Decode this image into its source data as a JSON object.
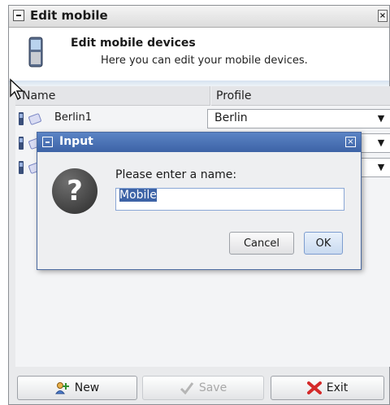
{
  "window": {
    "title": "Edit mobile",
    "header_title": "Edit mobile devices",
    "header_subtitle": "Here you can edit your mobile devices."
  },
  "table": {
    "columns": [
      "Name",
      "Profile"
    ],
    "rows": [
      {
        "name": "Berlin1",
        "profile": "Berlin"
      },
      {
        "name": "",
        "profile": ""
      },
      {
        "name": "",
        "profile": ""
      }
    ]
  },
  "buttons": {
    "new": "New",
    "save": "Save",
    "exit": "Exit"
  },
  "dialog": {
    "title": "Input",
    "prompt": "Please enter a name:",
    "input_value": "Mobile",
    "cancel": "Cancel",
    "ok": "OK"
  },
  "colors": {
    "accent": "#3d63a6",
    "dialog_title": "#4a72b6"
  }
}
